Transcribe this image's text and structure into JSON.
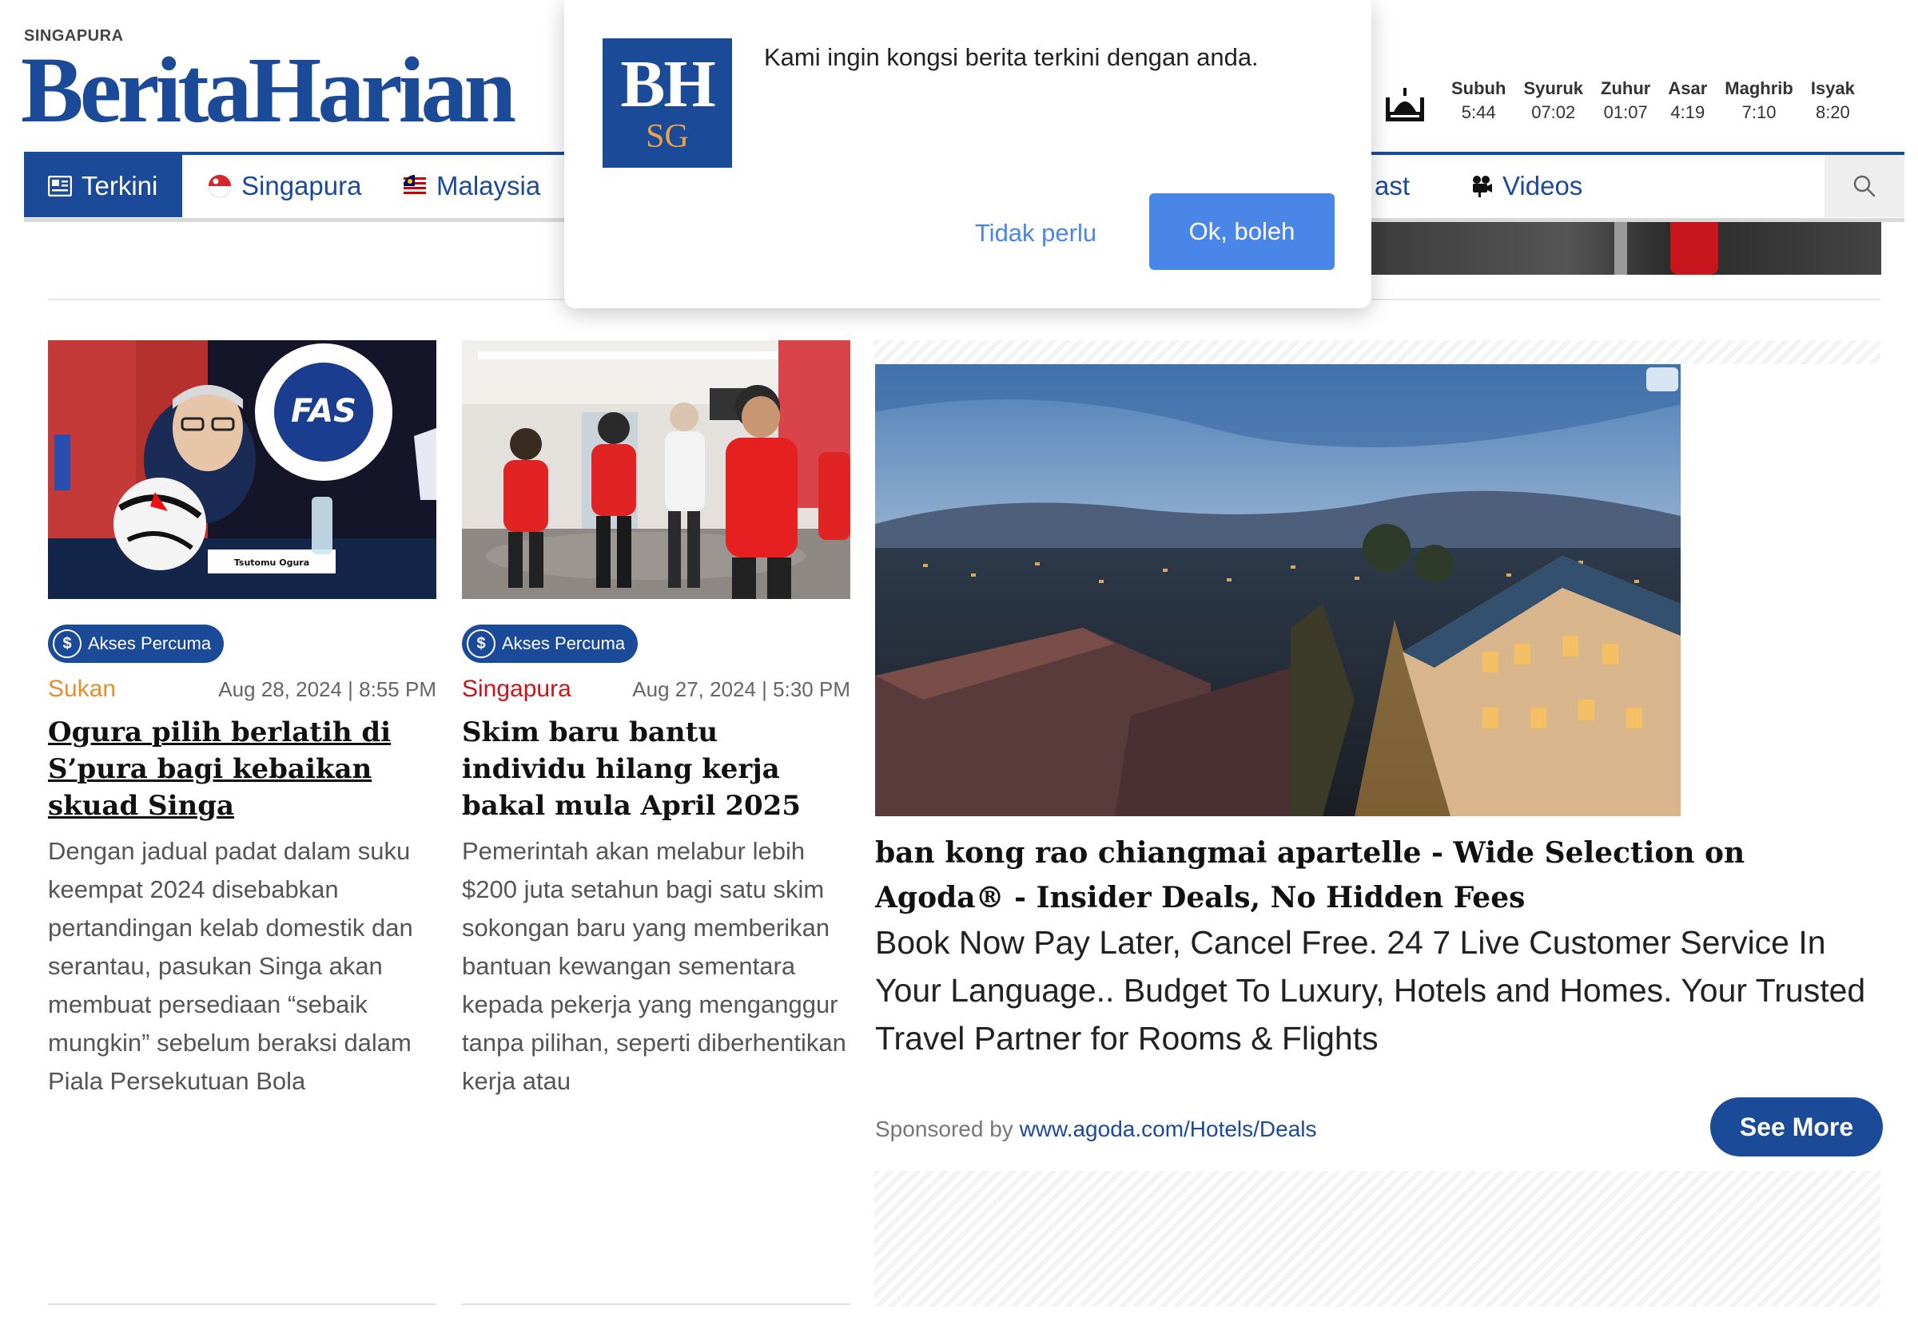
{
  "header": {
    "kicker": "SINGAPURA",
    "logo_text": "BeritaHarian",
    "brand_color": "#1b4a99"
  },
  "prayer_times": [
    {
      "name": "Subuh",
      "time": "5:44"
    },
    {
      "name": "Syuruk",
      "time": "07:02"
    },
    {
      "name": "Zuhur",
      "time": "01:07"
    },
    {
      "name": "Asar",
      "time": "4:19"
    },
    {
      "name": "Maghrib",
      "time": "7:10"
    },
    {
      "name": "Isyak",
      "time": "8:20"
    }
  ],
  "nav": {
    "items": [
      {
        "label": "Terkini",
        "icon": "newspaper-icon",
        "active": true
      },
      {
        "label": "Singapura",
        "icon": "singapore-flag-icon"
      },
      {
        "label": "Malaysia",
        "icon": "malaysia-flag-icon"
      },
      {
        "label": "ast",
        "icon": ""
      },
      {
        "label": "Videos",
        "icon": "video-camera-icon"
      }
    ],
    "search_icon": "search-icon"
  },
  "articles": [
    {
      "badge": "Akses Percuma",
      "category": "Sukan",
      "date": "Aug 28, 2024 | 8:55 PM",
      "headline": "Ogura pilih berlatih di S’pura bagi kebaikan skuad Singa",
      "summary": "Dengan jadual padat dalam suku keempat 2024 disebabkan pertandingan kelab domestik dan serantau, pasukan Singa akan membuat persediaan “sebaik mungkin” sebelum beraksi dalam Piala Persekutuan Bola",
      "image_caption": "Tsutomu Ogura",
      "image_logo": "FOOTBALL ASSOCIATION SINGAPORE"
    },
    {
      "badge": "Akses Percuma",
      "category": "Singapura",
      "date": "Aug 27, 2024 | 5:30 PM",
      "headline": "Skim baru bantu individu hilang kerja bakal mula April 2025",
      "summary": "Pemerintah akan melabur lebih $200 juta setahun bagi satu skim sokongan baru yang memberikan bantuan kewangan sementara kepada pekerja yang menganggur tanpa pilihan, seperti diberhentikan kerja atau"
    }
  ],
  "ad": {
    "title": "ban kong rao chiangmai apartelle - Wide Selection on Agoda® - Insider Deals, No Hidden Fees",
    "body": "Book Now Pay Later, Cancel Free. 24 7 Live Customer Service In Your Language.. Budget To Luxury, Hotels and Homes. Your Trusted Travel Partner for Rooms & Flights",
    "sponsored_by": "Sponsored by",
    "sponsor_link": "www.agoda.com/Hotels/Deals",
    "cta": "See More"
  },
  "popup": {
    "logo_top": "BH",
    "logo_bottom": "SG",
    "message": "Kami ingin kongsi berita terkini dengan anda.",
    "decline": "Tidak perlu",
    "accept": "Ok, boleh",
    "accept_color": "#4a86e8"
  }
}
